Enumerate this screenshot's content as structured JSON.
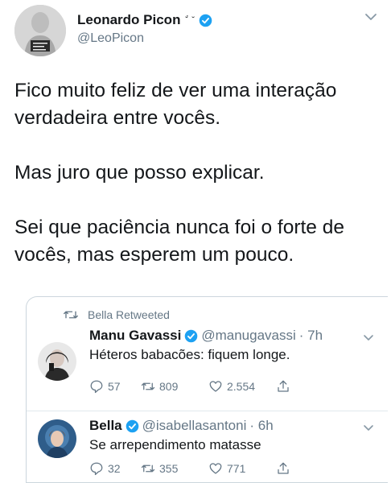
{
  "author": {
    "name": "Leonardo Picon",
    "name_deco": "˘́ ˘",
    "handle": "@LeoPicon"
  },
  "tweet": {
    "paragraphs": [
      "Fico muito feliz de ver uma interação verdadeira entre vocês.",
      "Mas juro que posso explicar.",
      "Sei que paciência nunca foi o forte de vocês, mas esperem um pouco."
    ]
  },
  "quoted": {
    "retweet_label": "Bella Retweeted",
    "tweets": [
      {
        "name": "Manu Gavassi",
        "handle": "@manugavassi",
        "time": "· 7h",
        "text": "Héteros babacões: fiquem longe.",
        "replies": "57",
        "retweets": "809",
        "likes": "2.554"
      },
      {
        "name": "Bella",
        "handle": "@isabellasantoni",
        "time": "· 6h",
        "text": "Se arrependimento matasse",
        "replies": "32",
        "retweets": "355",
        "likes": "771"
      }
    ]
  },
  "colors": {
    "verified": "#1da1f2",
    "secondary_text": "#657786",
    "border": "#ccd6dd"
  }
}
